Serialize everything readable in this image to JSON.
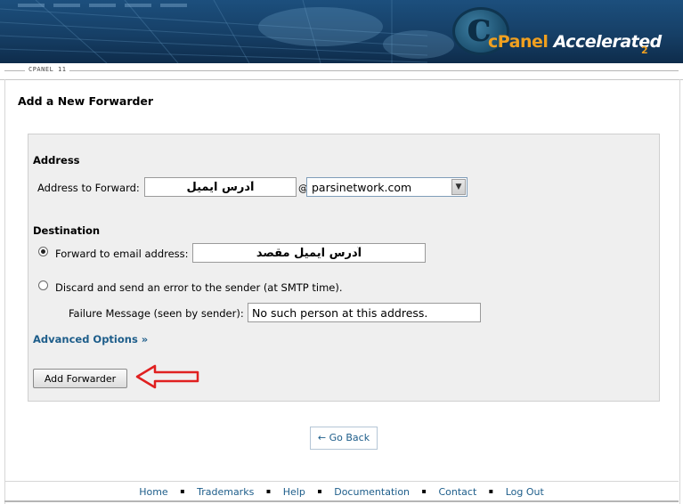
{
  "header": {
    "brand_main": "cPanel",
    "brand_accent": "Accelerated",
    "brand_suffix": "2",
    "version_label": "CPANEL 11"
  },
  "page": {
    "title": "Add a New Forwarder"
  },
  "form": {
    "address_section": "Address",
    "address_label": "Address to Forward:",
    "address_value": "آدرس ایمیل",
    "at_sign": "@",
    "domain_selected": "parsinetwork.com",
    "destination_section": "Destination",
    "forward_option_label": "Forward to email address:",
    "forward_value": "آدرس ایمیل مقصد",
    "discard_option_label": "Discard and send an error to the sender (at SMTP time).",
    "failure_label": "Failure Message (seen by sender):",
    "failure_value": "No such person at this address.",
    "advanced_options": "Advanced Options »",
    "submit_label": "Add Forwarder",
    "selected_option": "forward"
  },
  "navigation": {
    "go_back": "← Go Back"
  },
  "footer": {
    "links": [
      "Home",
      "Trademarks",
      "Help",
      "Documentation",
      "Contact",
      "Log Out"
    ],
    "separator": "▪"
  },
  "colors": {
    "link": "#1d5d8a",
    "arrow": "#e02020",
    "panel_bg": "#efefef",
    "banner_bg": "#163f66",
    "brand_orange": "#f0a020"
  }
}
